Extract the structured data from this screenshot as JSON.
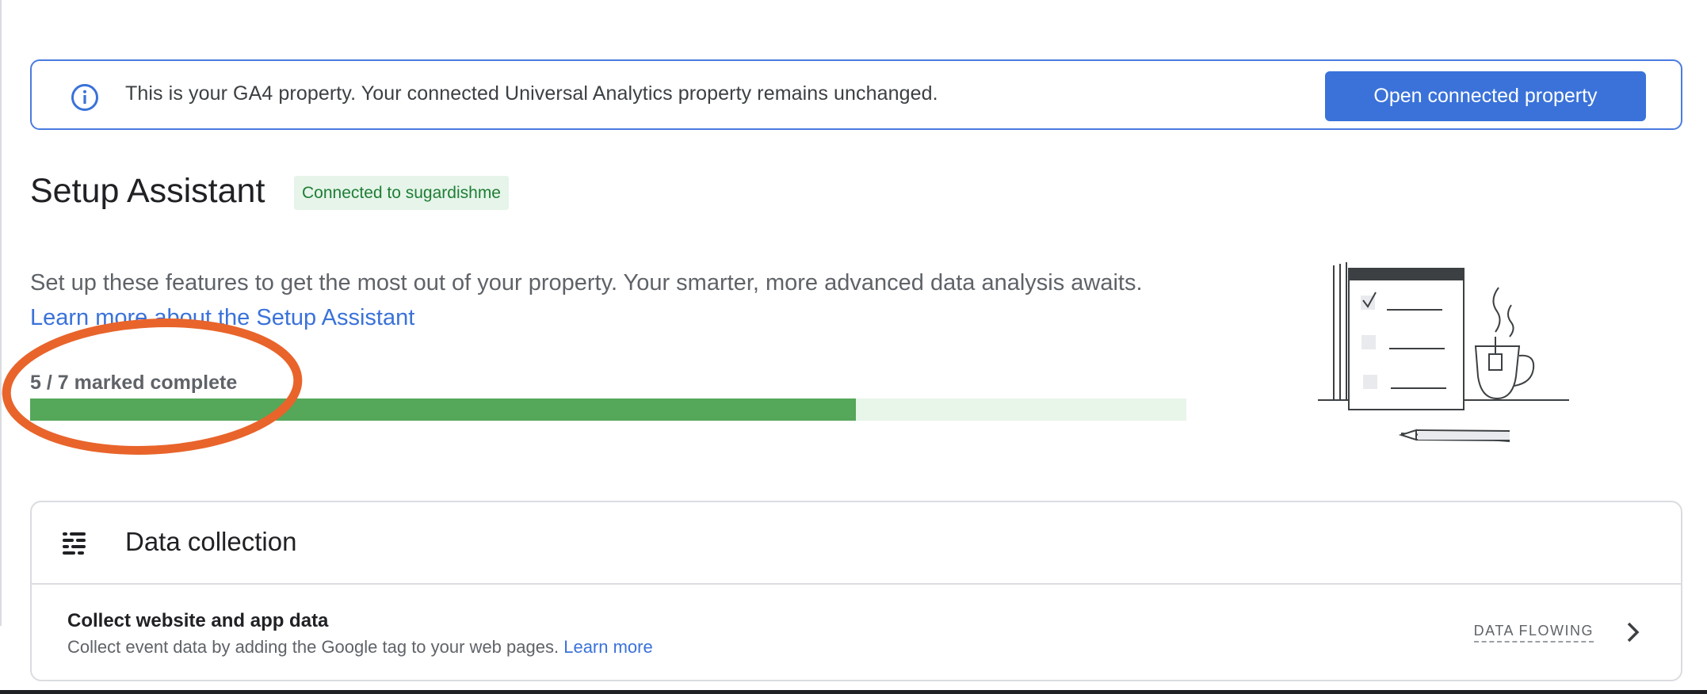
{
  "banner": {
    "icon": "info-icon",
    "message": "This is your GA4 property. Your connected Universal Analytics property remains unchanged.",
    "button_label": "Open connected property"
  },
  "header": {
    "title": "Setup Assistant",
    "status_chip": "Connected to sugardishme"
  },
  "intro": {
    "description": "Set up these features to get the most out of your property. Your smarter, more advanced data analysis awaits.",
    "link_text": "Learn more about the Setup Assistant"
  },
  "progress": {
    "label": "5 / 7 marked complete",
    "completed": 5,
    "total": 7,
    "fill_color": "#55a759",
    "track_color": "#e8f5e9"
  },
  "annotation": {
    "shape": "ellipse",
    "color": "#e8642b"
  },
  "illustration": {
    "icon": "checklist-and-coffee-illustration"
  },
  "data_collection": {
    "icon": "data-collection-icon",
    "title": "Data collection",
    "rows": [
      {
        "title": "Collect website and app data",
        "description": "Collect event data by adding the Google tag to your web pages.",
        "link_text": "Learn more",
        "status": "DATA FLOWING",
        "icon": "chevron-right-icon"
      }
    ]
  },
  "colors": {
    "accent": "#3a72d9",
    "success": "#1e7e34"
  }
}
